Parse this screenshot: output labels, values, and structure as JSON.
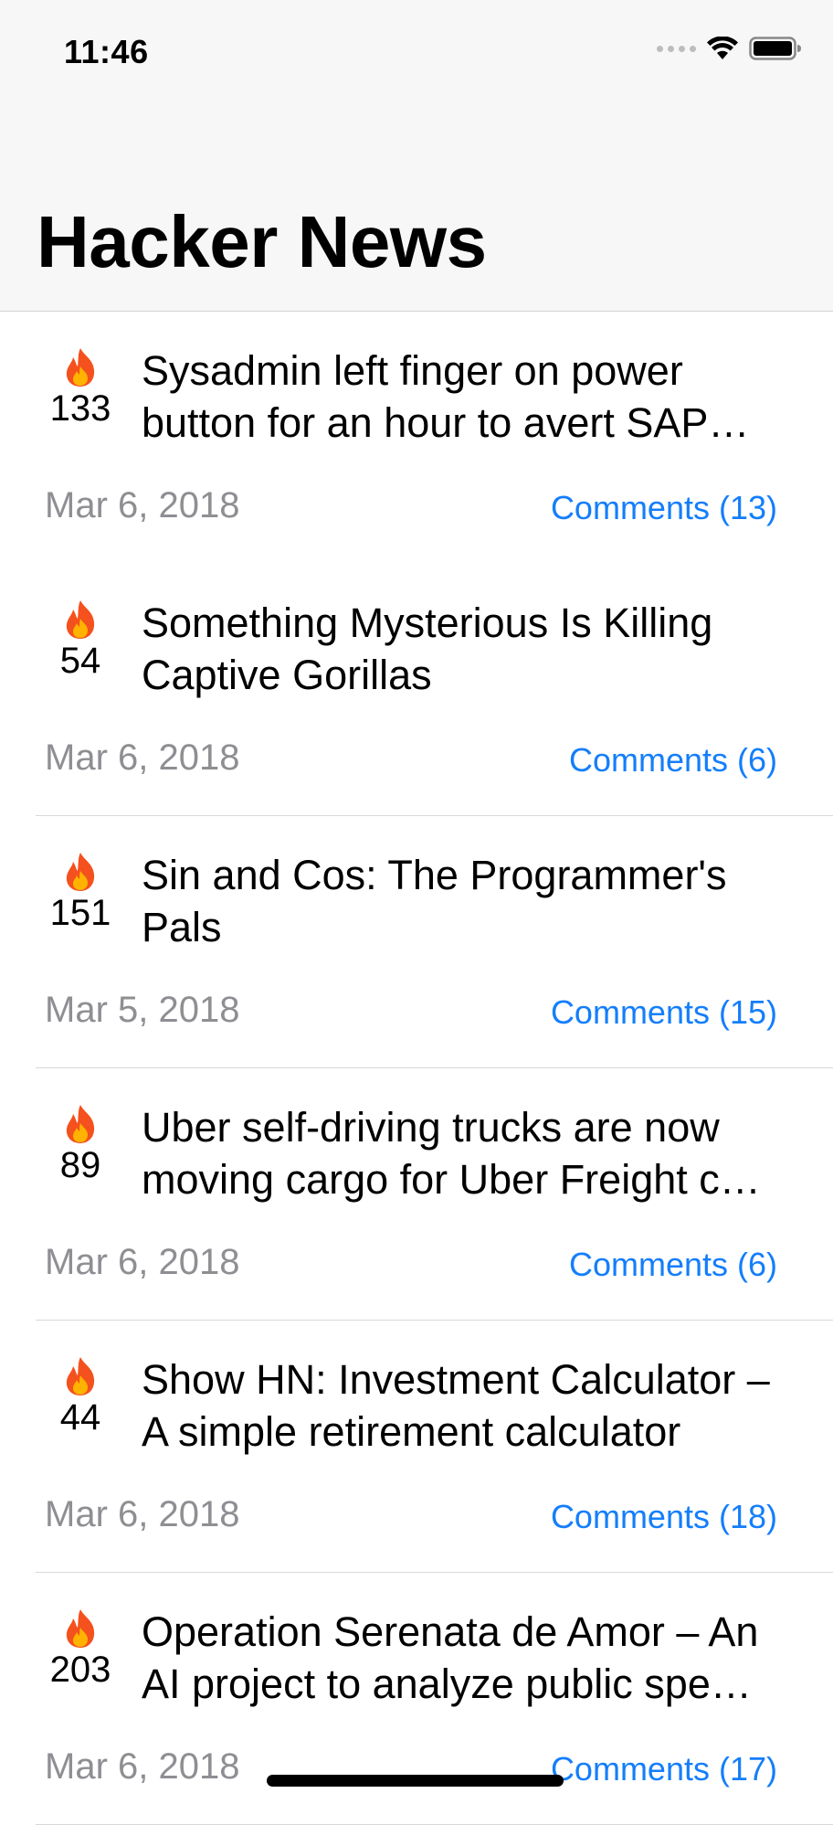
{
  "status_bar": {
    "time": "11:46",
    "icons": [
      "signal-dots-icon",
      "wifi-icon",
      "battery-icon"
    ]
  },
  "nav": {
    "title": "Hacker News"
  },
  "colors": {
    "link": "#147efb",
    "secondary_text": "#8e8e93",
    "nav_background": "#f7f7f7"
  },
  "stories": [
    {
      "score": "133",
      "title": "Sysadmin left finger on power button for an hour to avert SAP…",
      "date": "Mar 6, 2018",
      "comments": "Comments (13)"
    },
    {
      "score": "54",
      "title": "Something Mysterious Is Killing Captive Gorillas",
      "date": "Mar 6, 2018",
      "comments": "Comments (6)"
    },
    {
      "score": "151",
      "title": "Sin and Cos: The Programmer's Pals",
      "date": "Mar 5, 2018",
      "comments": "Comments (15)"
    },
    {
      "score": "89",
      "title": "Uber self-driving trucks are now moving cargo for Uber Freight c…",
      "date": "Mar 6, 2018",
      "comments": "Comments (6)"
    },
    {
      "score": "44",
      "title": "Show HN: Investment Calculator – A simple retirement calculator",
      "date": "Mar 6, 2018",
      "comments": "Comments (18)"
    },
    {
      "score": "203",
      "title": "Operation Serenata de Amor – An AI project to analyze public spe…",
      "date": "Mar 6, 2018",
      "comments": "Comments (17)"
    }
  ]
}
